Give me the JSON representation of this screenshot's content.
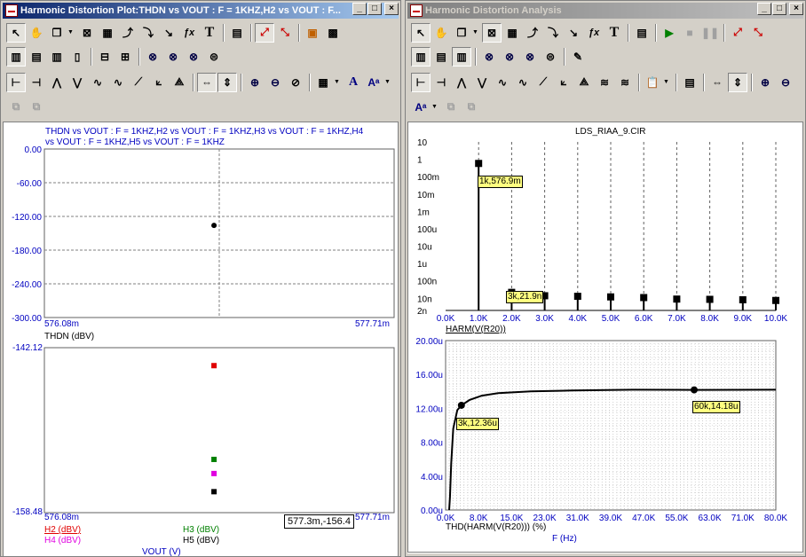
{
  "left_window": {
    "title": "Harmonic Distortion Plot:THDN vs VOUT : F = 1KHZ,H2 vs VOUT : F...",
    "plot_title_line1": "THDN vs VOUT : F = 1KHZ,H2 vs VOUT : F = 1KHZ,H3 vs VOUT : F = 1KHZ,H4",
    "plot_title_line2": "vs VOUT : F = 1KHZ,H5 vs VOUT : F = 1KHZ",
    "thdn_plot": {
      "y_ticks": [
        "0.00",
        "-60.00",
        "-120.00",
        "-180.00",
        "-240.00",
        "-300.00"
      ],
      "x_min": "576.08m",
      "x_max": "577.71m",
      "xlabel": "THDN (dBV)"
    },
    "harm_plot": {
      "y_max": "-142.12",
      "y_min": "-158.48",
      "x_min": "576.08m",
      "x_max": "577.71m",
      "cursor_readout": "577.3m,-156.4",
      "legend": {
        "h2": "H2 (dBV)",
        "h3": "H3 (dBV)",
        "h4": "H4 (dBV)",
        "h5": "H5 (dBV)"
      },
      "xlabel": "VOUT (V)"
    }
  },
  "right_window": {
    "title": "Harmonic Distortion Analysis",
    "harm_plot": {
      "title": "LDS_RIAA_9.CIR",
      "y_ticks": [
        "10",
        "1",
        "100m",
        "10m",
        "1m",
        "100u",
        "10u",
        "1u",
        "100n",
        "10n",
        "2n"
      ],
      "x_ticks": [
        "0.0K",
        "1.0K",
        "2.0K",
        "3.0K",
        "4.0K",
        "5.0K",
        "6.0K",
        "7.0K",
        "8.0K",
        "9.0K",
        "10.0K"
      ],
      "xlabel": "HARM(V(R20))",
      "tag1": "1k,576.9m",
      "tag2": "3k,21.9n"
    },
    "thd_plot": {
      "y_ticks": [
        "20.00u",
        "16.00u",
        "12.00u",
        "8.00u",
        "4.00u",
        "0.00u"
      ],
      "x_ticks": [
        "0.0K",
        "8.0K",
        "15.0K",
        "23.0K",
        "31.0K",
        "39.0K",
        "47.0K",
        "55.0K",
        "63.0K",
        "71.0K",
        "80.0K"
      ],
      "xlabel": "THD(HARM(V(R20))) (%)",
      "xunit": "F (Hz)",
      "tag1": "3k,12.36u",
      "tag2": "60k,14.18u"
    }
  },
  "window_buttons": {
    "minimize": "_",
    "maximize": "□",
    "close": "×"
  },
  "colors": {
    "h2": "#e00000",
    "h3": "#008000",
    "h4": "#e000e0",
    "h5": "#000000",
    "axis_blue": "#0000c0",
    "title_active": "#0a246a"
  },
  "chart_data": [
    {
      "type": "scatter",
      "title": "",
      "xlabel": "THDN (dBV)",
      "xlim": [
        576.08,
        577.71
      ],
      "ylim": [
        -300,
        0
      ],
      "series": [
        {
          "name": "THDN (dBV)",
          "points": [
            [
              577.3,
              -136
            ]
          ]
        }
      ]
    },
    {
      "type": "scatter",
      "title": "",
      "xlabel": "VOUT (V)",
      "xlim": [
        576.08,
        577.71
      ],
      "ylim": [
        -158.48,
        -142.12
      ],
      "series": [
        {
          "name": "H2 (dBV)",
          "points": [
            [
              577.3,
              -143.9
            ]
          ]
        },
        {
          "name": "H3 (dBV)",
          "points": [
            [
              577.3,
              -153.2
            ]
          ]
        },
        {
          "name": "H4 (dBV)",
          "points": [
            [
              577.3,
              -154.6
            ]
          ]
        },
        {
          "name": "H5 (dBV)",
          "points": [
            [
              577.3,
              -156.4
            ]
          ]
        }
      ]
    },
    {
      "type": "bar",
      "title": "LDS_RIAA_9.CIR",
      "xlabel": "HARM(V(R20))",
      "ylog": true,
      "ylim": [
        2e-09,
        10
      ],
      "xlim": [
        0,
        10000
      ],
      "x": [
        1000,
        2000,
        3000,
        4000,
        5000,
        6000,
        7000,
        8000,
        9000,
        10000
      ],
      "values": [
        0.5769,
        2.19e-08,
        1.4e-08,
        1.3e-08,
        1.2e-08,
        1.1e-08,
        9e-09,
        8.7e-09,
        8.2e-09,
        7.5e-09
      ]
    },
    {
      "type": "line",
      "title": "",
      "xlabel": "F (Hz)",
      "ylabel": "THD(HARM(V(R20))) (%)",
      "xlim": [
        0,
        80000
      ],
      "ylim": [
        0,
        2e-05
      ],
      "series": [
        {
          "name": "THD(HARM(V(R20))) (%)",
          "x": [
            0,
            200,
            500,
            1000,
            2000,
            3000,
            5000,
            8000,
            12000,
            20000,
            30000,
            45000,
            60000,
            80000
          ],
          "y": [
            0,
            1.5e-06,
            5.5e-06,
            9.6e-06,
            1.18e-05,
            1.236e-05,
            1.3e-05,
            1.35e-05,
            1.38e-05,
            1.4e-05,
            1.41e-05,
            1.42e-05,
            1.418e-05,
            1.42e-05
          ]
        }
      ]
    }
  ]
}
